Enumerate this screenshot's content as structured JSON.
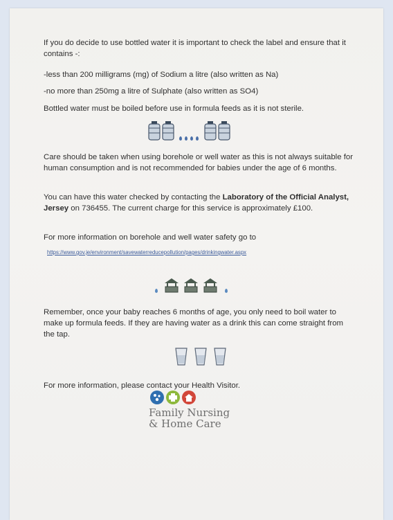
{
  "document": {
    "para1": "If you do decide to use bottled water it is important to check the label and ensure that it contains -:",
    "para2": "-less than 200 milligrams (mg) of Sodium a litre (also written as Na)",
    "para3": "-no more than 250mg a litre of Sulphate (also written as SO4)",
    "para4": "Bottled water must be boiled before use in formula feeds as it is not sterile.",
    "para5": "Care should be taken when using borehole or well water as this is not always suitable for human consumption and is not recommended for babies under the age of 6 months.",
    "para6_pre": "You can have this water checked by contacting the ",
    "para6_bold": "Laboratory of the Official Analyst, Jersey",
    "para6_post": " on 736455. The current charge for this service is approximately £100.",
    "para7": "For more information on borehole and well water safety go to",
    "link": "https://www.gov.je/environment/savewaterreducepollution/pages/drinkingwater.aspx",
    "para8": "Remember, once your baby reaches 6 months of age, you only need to boil water to make up formula feeds. If they are having water as a drink this can come straight from the tap.",
    "para9": "For more information, please contact your Health Visitor.",
    "logo_line1": "Family Nursing",
    "logo_line2": "& Home Care"
  },
  "icons": {
    "bottles": "bottle-icon",
    "drops": "water-drop-icon",
    "wells": "well-icon",
    "glasses": "glass-icon"
  },
  "colors": {
    "logo_blue": "#2f6fb0",
    "logo_green": "#8db83c",
    "logo_red": "#d2473a",
    "text": "#2f2f2f"
  }
}
